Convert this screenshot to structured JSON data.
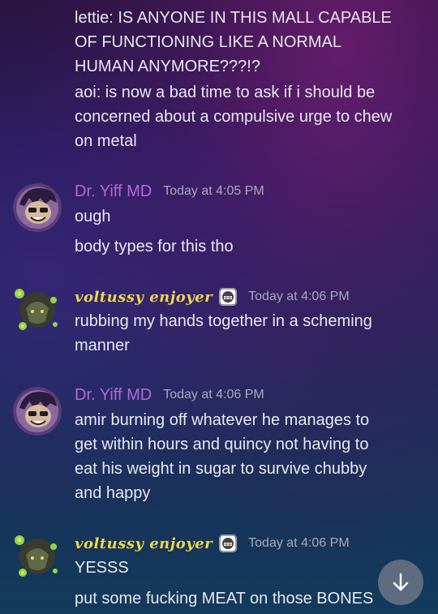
{
  "messages": {
    "prev_lines": [
      "lettie: IS ANYONE IN THIS MALL CAPABLE",
      "OF FUNCTIONING LIKE A NORMAL",
      "HUMAN ANYMORE???!?",
      "aoi: is now a bad time to ask if i should be",
      "concerned about a compulsive urge to chew",
      "on metal"
    ],
    "group1": {
      "author": "Dr. Yiff MD",
      "timestamp": "Today at 4:05 PM",
      "line1": "ough",
      "line2": "body types for this tho"
    },
    "group2": {
      "author": "voltussy enjoyer",
      "timestamp": "Today at 4:06 PM",
      "lines": [
        "rubbing my hands together in a scheming",
        "manner"
      ]
    },
    "group3": {
      "author": "Dr. Yiff MD",
      "timestamp": "Today at 4:06 PM",
      "lines": [
        "amir burning off whatever he manages to",
        "get within hours and quincy not having to",
        "eat his weight in sugar to survive chubby",
        "and happy"
      ]
    },
    "group4": {
      "author": "voltussy enjoyer",
      "timestamp": "Today at 4:06 PM",
      "line1": "YESSS",
      "line2": "put some fucking MEAT on those BONES"
    }
  },
  "icons": {
    "avatar_yiff": "dr-yiff-avatar",
    "avatar_volt": "voltussy-avatar",
    "badge": "grinning-face-badge-icon",
    "scroll": "arrow-down-icon"
  },
  "colors": {
    "yiff_name": "#b06ad6",
    "volt_name": "#f0d64a",
    "timestamp": "#a9aab8",
    "text": "#e8e8ee"
  }
}
